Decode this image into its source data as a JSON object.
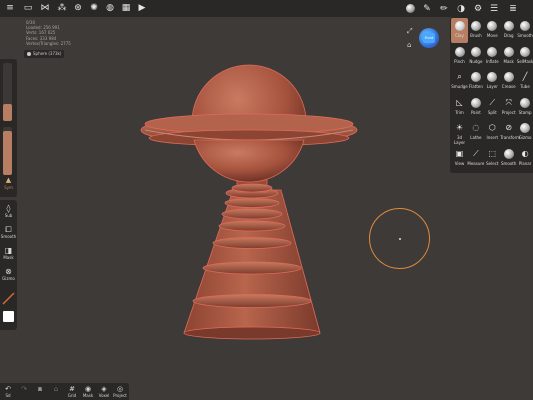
{
  "info": {
    "lines": [
      "0/30",
      "Loaded: 256 991",
      "Verts: 167 025",
      "Faces: 333 984",
      "Vertex/Triangles: 2775"
    ]
  },
  "scene": {
    "object_label": "Sphere (373k)"
  },
  "topbar": {
    "left_icons": [
      "menu-icon",
      "folder-icon",
      "share-icon",
      "scene-icon",
      "settings-icon",
      "lighting-icon",
      "material-icon",
      "image-icon",
      "video-icon"
    ],
    "right_icons": [
      "matcap-icon",
      "brush-stroke-icon",
      "pen-icon",
      "palette-icon",
      "gear-icon",
      "layers-icon",
      "hamburger-icon"
    ]
  },
  "left_tools": {
    "sym_label": "Sym",
    "sub_label": "Sub",
    "smooth_label": "Smooth",
    "mask_label": "Mask",
    "gizmo_label": "Gizmo"
  },
  "bottom": {
    "items": [
      {
        "label": "Sd",
        "icon": "↶",
        "dim": false
      },
      {
        "label": "",
        "icon": "↷",
        "dim": true
      },
      {
        "label": "",
        "icon": "⧈",
        "dim": false
      },
      {
        "label": "",
        "icon": "⌂",
        "dim": true
      },
      {
        "label": "Grid",
        "icon": "#",
        "dim": false
      },
      {
        "label": "Mask",
        "icon": "◉",
        "dim": false
      },
      {
        "label": "Voxel",
        "icon": "◈",
        "dim": false
      },
      {
        "label": "Project",
        "icon": "◎",
        "dim": false
      }
    ]
  },
  "gizmo": {
    "face_label": "Front"
  },
  "tools": [
    {
      "label": "Clay",
      "glyph": "",
      "active": true
    },
    {
      "label": "Brush",
      "glyph": ""
    },
    {
      "label": "Move",
      "glyph": ""
    },
    {
      "label": "Drag",
      "glyph": ""
    },
    {
      "label": "Smooth",
      "glyph": ""
    },
    {
      "label": "Pinch",
      "glyph": ""
    },
    {
      "label": "Nudge",
      "glyph": ""
    },
    {
      "label": "Inflate",
      "glyph": ""
    },
    {
      "label": "Mask",
      "glyph": ""
    },
    {
      "label": "SelMask",
      "glyph": ""
    },
    {
      "label": "Smudge",
      "glyph": "⌕"
    },
    {
      "label": "Flatten",
      "glyph": ""
    },
    {
      "label": "Layer",
      "glyph": ""
    },
    {
      "label": "Crease",
      "glyph": ""
    },
    {
      "label": "Tube",
      "glyph": "╱"
    },
    {
      "label": "Trim",
      "glyph": "◺"
    },
    {
      "label": "Paint",
      "glyph": ""
    },
    {
      "label": "Split",
      "glyph": "⟋"
    },
    {
      "label": "Project",
      "glyph": "⤧"
    },
    {
      "label": "Stamp",
      "glyph": ""
    },
    {
      "label": "3d Layer",
      "glyph": "☀"
    },
    {
      "label": "Lathe",
      "glyph": "◌"
    },
    {
      "label": "Insert",
      "glyph": "⬡"
    },
    {
      "label": "Transform",
      "glyph": "⊘"
    },
    {
      "label": "Gizmo",
      "glyph": ""
    },
    {
      "label": "View",
      "glyph": "▣"
    },
    {
      "label": "Measure",
      "glyph": "⟋"
    },
    {
      "label": "Select",
      "glyph": "⬚"
    },
    {
      "label": "Smooth",
      "glyph": ""
    },
    {
      "label": "Planar",
      "glyph": "◐"
    }
  ],
  "colors": {
    "accent": "#b87e63",
    "clay": "#b35a44",
    "cursor": "#e08a3c"
  }
}
